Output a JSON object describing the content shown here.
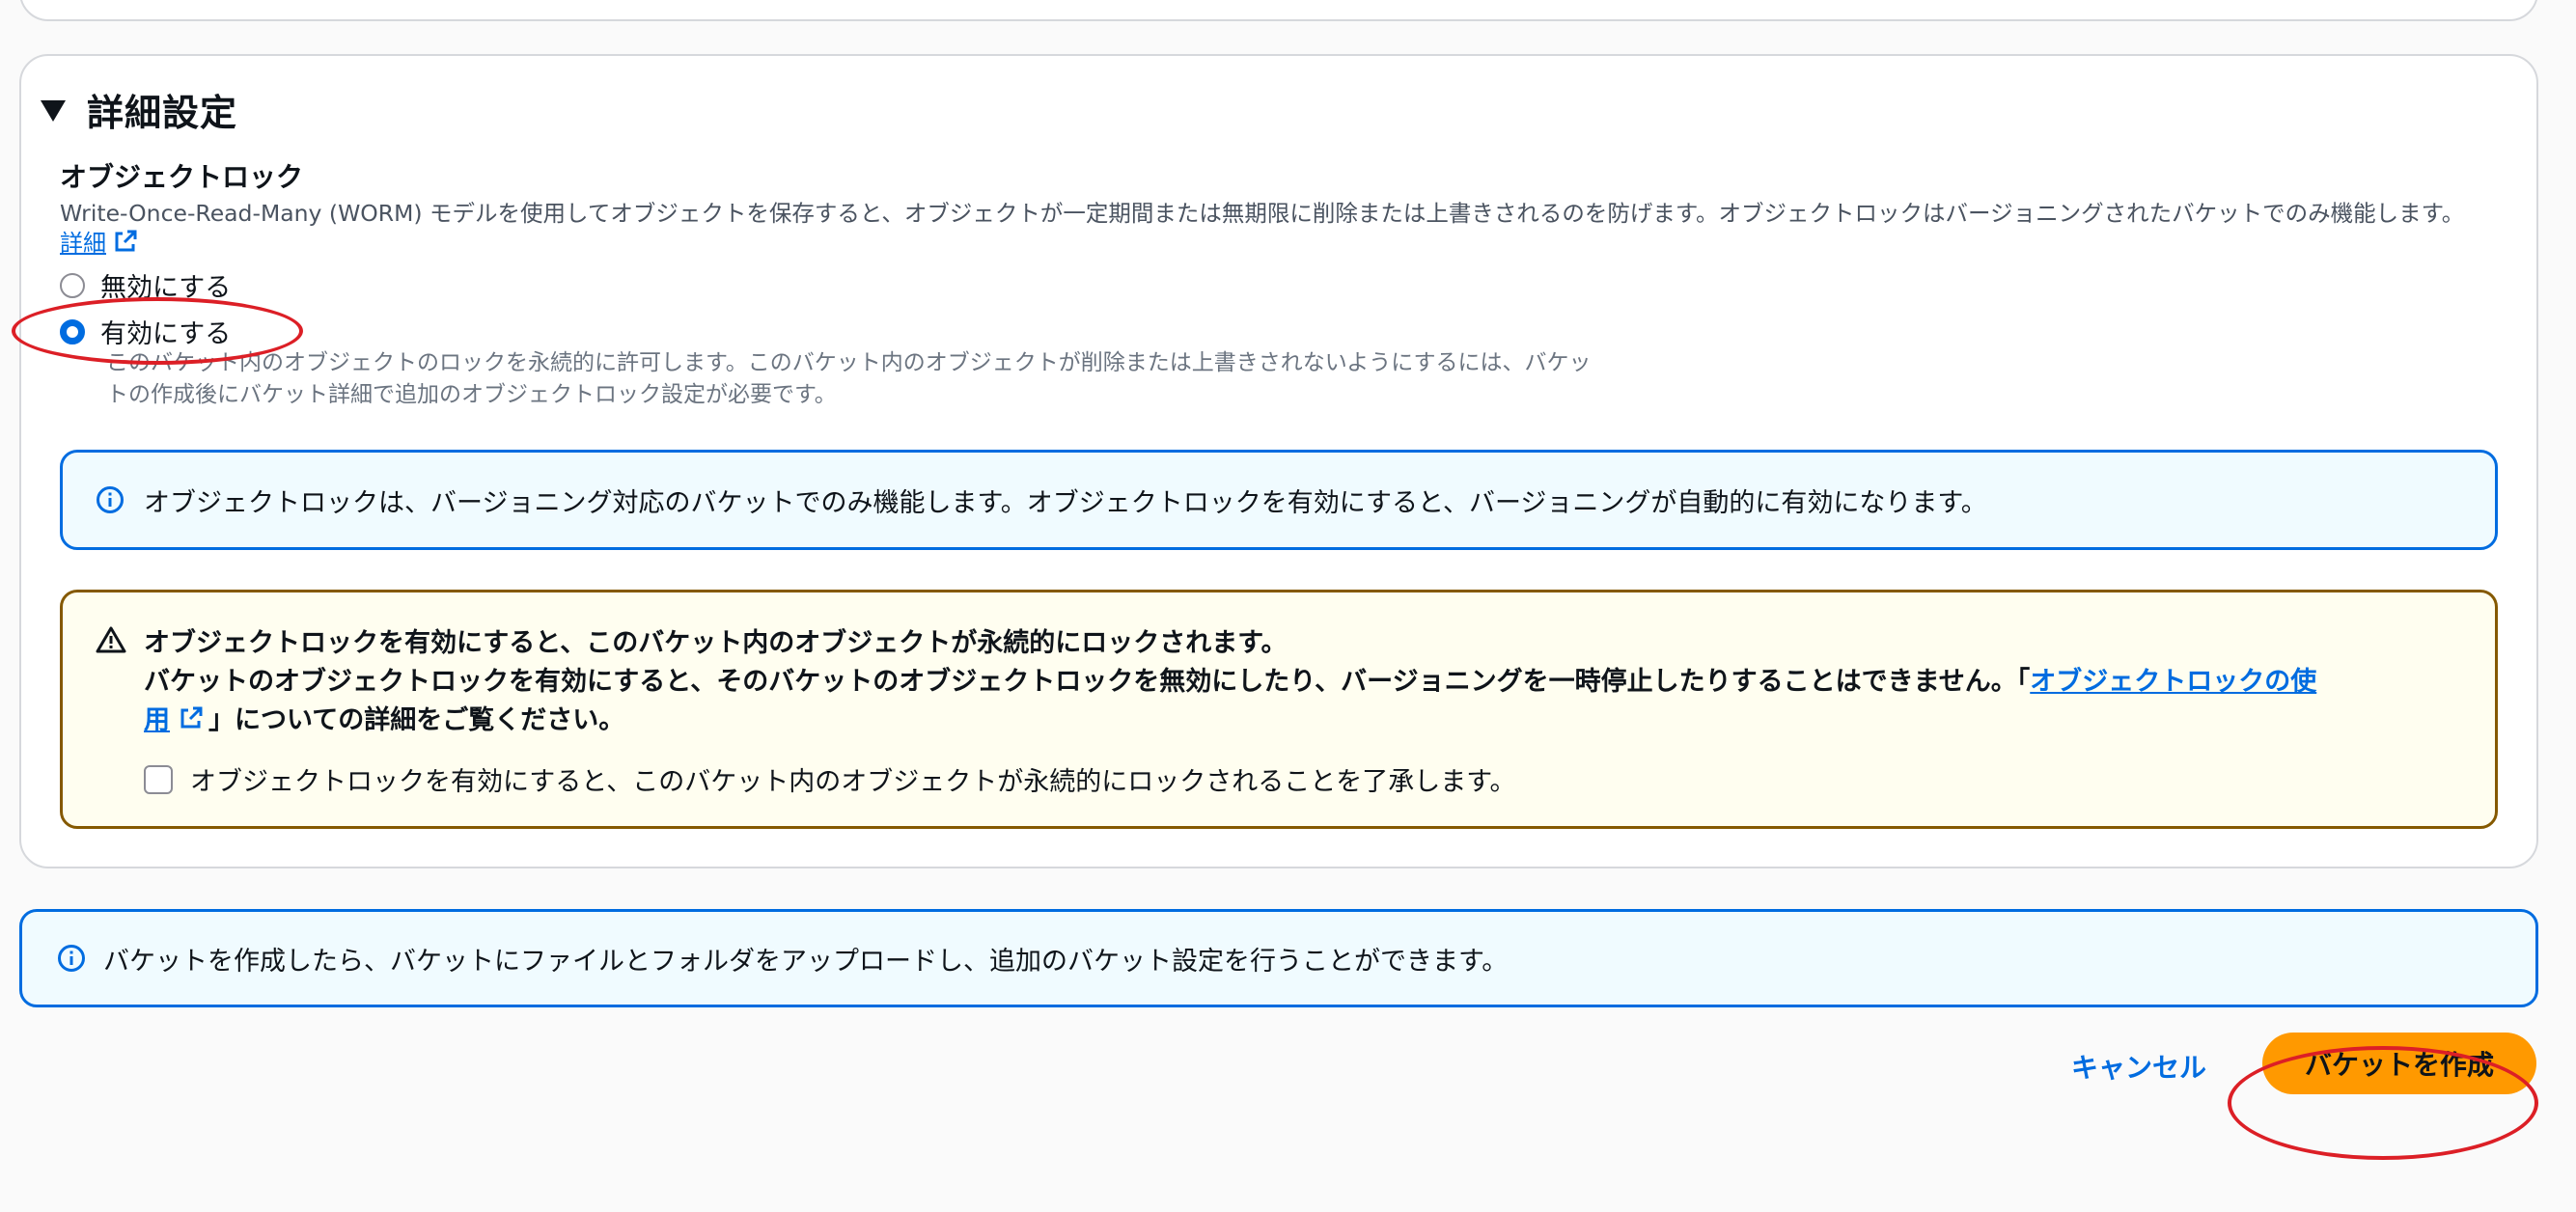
{
  "section": {
    "title": "詳細設定"
  },
  "object_lock": {
    "label": "オブジェクトロック",
    "description": "Write-Once-Read-Many (WORM) モデルを使用してオブジェクトを保存すると、オブジェクトが一定期間または無期限に削除または上書きされるのを防げます。オブジェクトロックはバージョニングされたバケットでのみ機能します。",
    "detail_link": "詳細",
    "options": [
      {
        "label": "無効にする",
        "selected": false
      },
      {
        "label": "有効にする",
        "selected": true
      }
    ],
    "enabled_desc_line1": "このバケット内のオブジェクトのロックを永続的に許可します。このバケット内のオブジェクトが削除または上書きされないようにするには、バケッ",
    "enabled_desc_line2": "トの作成後にバケット詳細で追加のオブジェクトロック設定が必要です。"
  },
  "info_versioning": {
    "text": "オブジェクトロックは、バージョニング対応のバケットでのみ機能します。オブジェクトロックを有効にすると、バージョニングが自動的に有効になります。"
  },
  "warning": {
    "heading": "オブジェクトロックを有効にすると、このバケット内のオブジェクトが永続的にロックされます。",
    "body_prefix": "バケットのオブジェクトロックを有効にすると、そのバケットのオブジェクトロックを無効にしたり、バージョニングを一時停止したりすることはできません。「",
    "link_part1": "オブジェクトロックの使",
    "link_part2": "用",
    "body_suffix": "」についての詳細をご覧ください。",
    "ack_label": "オブジェクトロックを有効にすると、このバケット内のオブジェクトが永続的にロックされることを了承します。"
  },
  "info_after_create": {
    "text": "バケットを作成したら、バケットにファイルとフォルダをアップロードし、追加のバケット設定を行うことができます。"
  },
  "actions": {
    "cancel_label": "キャンセル",
    "create_label": "バケットを作成"
  },
  "colors": {
    "accent": "#006ce0",
    "primary_button": "#ff9900",
    "warning_border": "#855900",
    "annotation": "#dc1f26"
  },
  "icons": {
    "collapse": "caret-down-icon",
    "external": "external-link-icon",
    "info": "info-icon",
    "warning": "warning-icon"
  }
}
